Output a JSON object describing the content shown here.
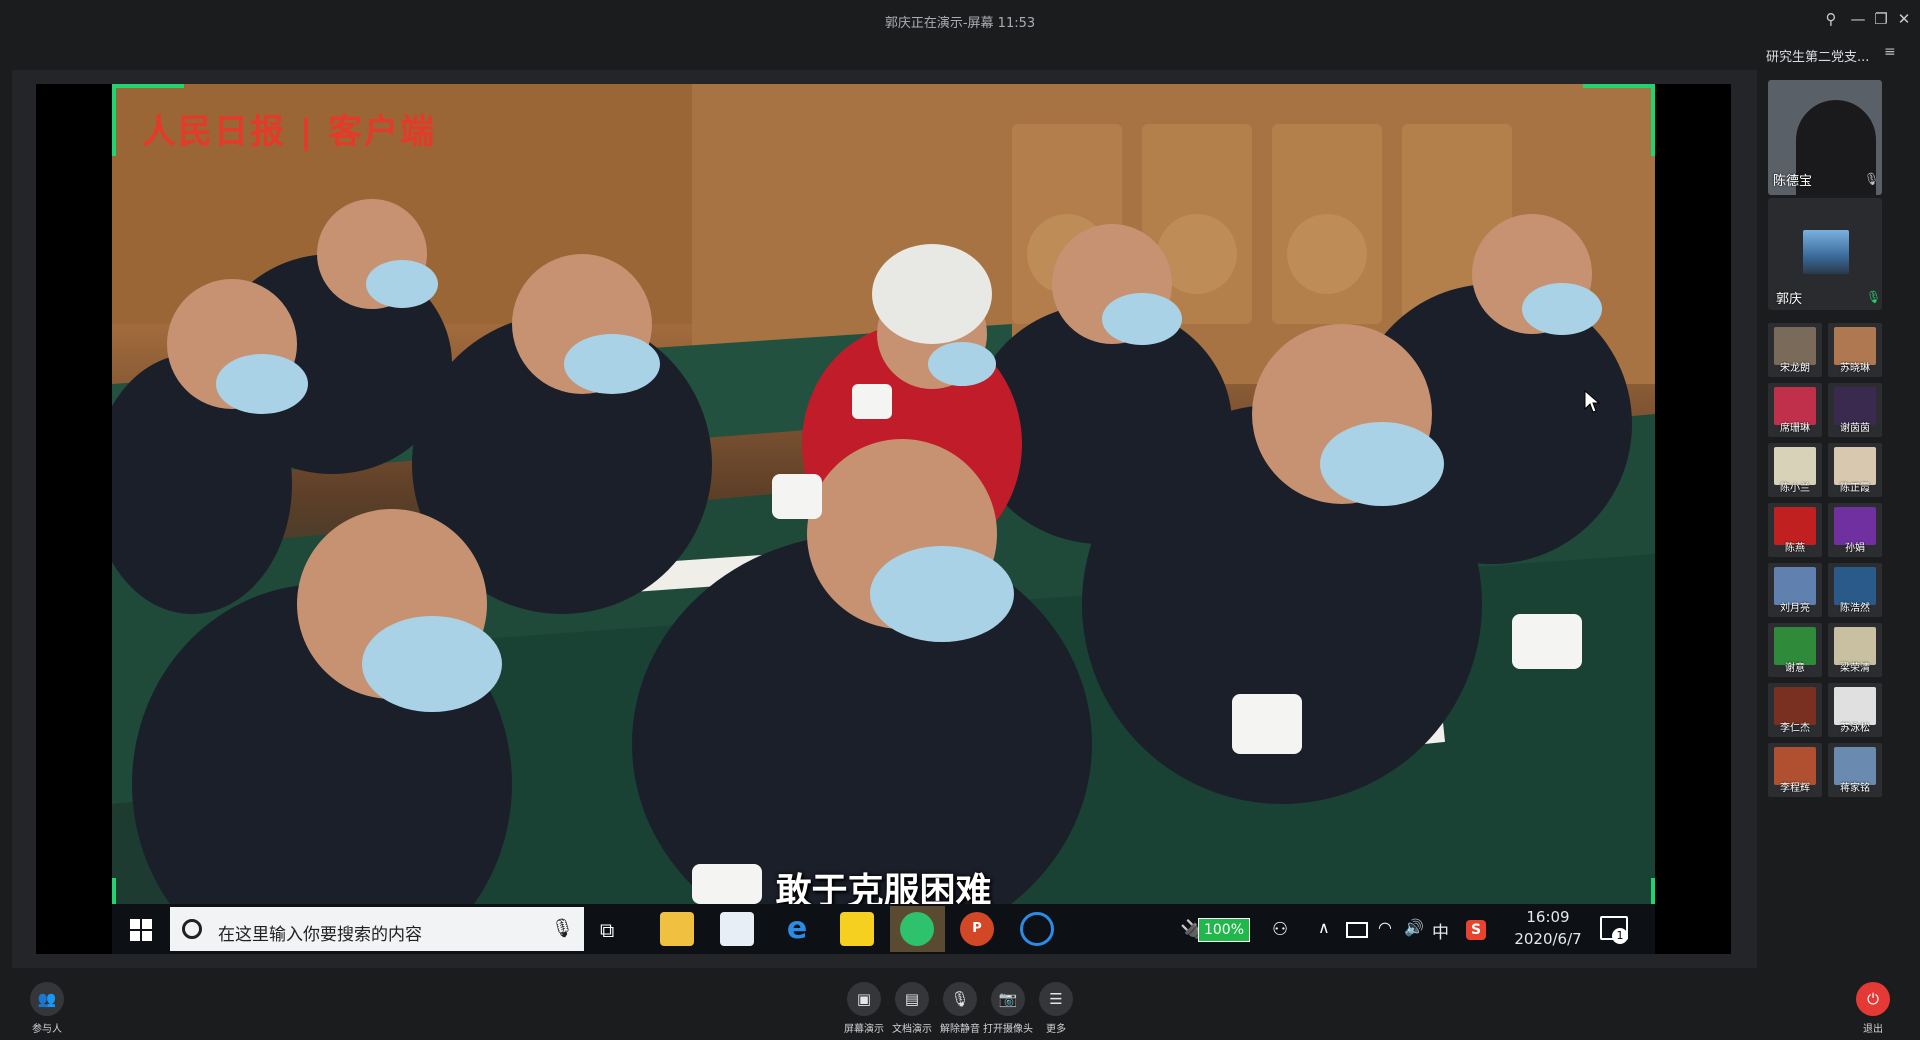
{
  "window": {
    "title": "郭庆正在演示-屏幕 11:53",
    "controls": [
      "pin-icon",
      "minimize-icon",
      "restore-icon",
      "close-icon"
    ]
  },
  "shared_screen": {
    "watermark": "人民日报 | 客户端",
    "subtitle": "敢于克服困难",
    "taskbar": {
      "search_placeholder": "在这里输入你要搜索的内容",
      "battery": "100%",
      "ime": "中",
      "time": "16:09",
      "date": "2020/6/7",
      "notification_count": "1"
    }
  },
  "sidebar": {
    "room_title": "研究生第二党支...",
    "featured": [
      {
        "name": "陈德宝",
        "mic": "muted"
      },
      {
        "name": "郭庆",
        "mic": "active"
      }
    ],
    "participants": [
      {
        "name": "宋龙朗",
        "color": "#7a6a5a"
      },
      {
        "name": "苏晓琳",
        "color": "#b07850"
      },
      {
        "name": "席珊琳",
        "color": "#c0304a"
      },
      {
        "name": "谢茵茵",
        "color": "#3a2a50"
      },
      {
        "name": "陈小兰",
        "color": "#d8d2b8"
      },
      {
        "name": "陈正霞",
        "color": "#d8c8b0"
      },
      {
        "name": "陈燕",
        "color": "#c02020"
      },
      {
        "name": "孙娟",
        "color": "#7030a0"
      },
      {
        "name": "刘月亮",
        "color": "#6080b0"
      },
      {
        "name": "陈浩然",
        "color": "#2a5a8a"
      },
      {
        "name": "谢意",
        "color": "#2f8a3a"
      },
      {
        "name": "梁荣清",
        "color": "#c8c0a0"
      },
      {
        "name": "李仁杰",
        "color": "#7a3020"
      },
      {
        "name": "苏泳松",
        "color": "#e0e0e0"
      },
      {
        "name": "李程辉",
        "color": "#b05030"
      },
      {
        "name": "蒋家铭",
        "color": "#6a8ab0"
      }
    ]
  },
  "controls": {
    "participants": "参与人",
    "screen_share": "屏幕演示",
    "doc_share": "文档演示",
    "unmute": "解除静音",
    "camera": "打开摄像头",
    "more": "更多",
    "exit": "退出"
  },
  "colors": {
    "accent_green": "#22d46f",
    "exit_red": "#e53935",
    "background": "#1b1c1e"
  }
}
